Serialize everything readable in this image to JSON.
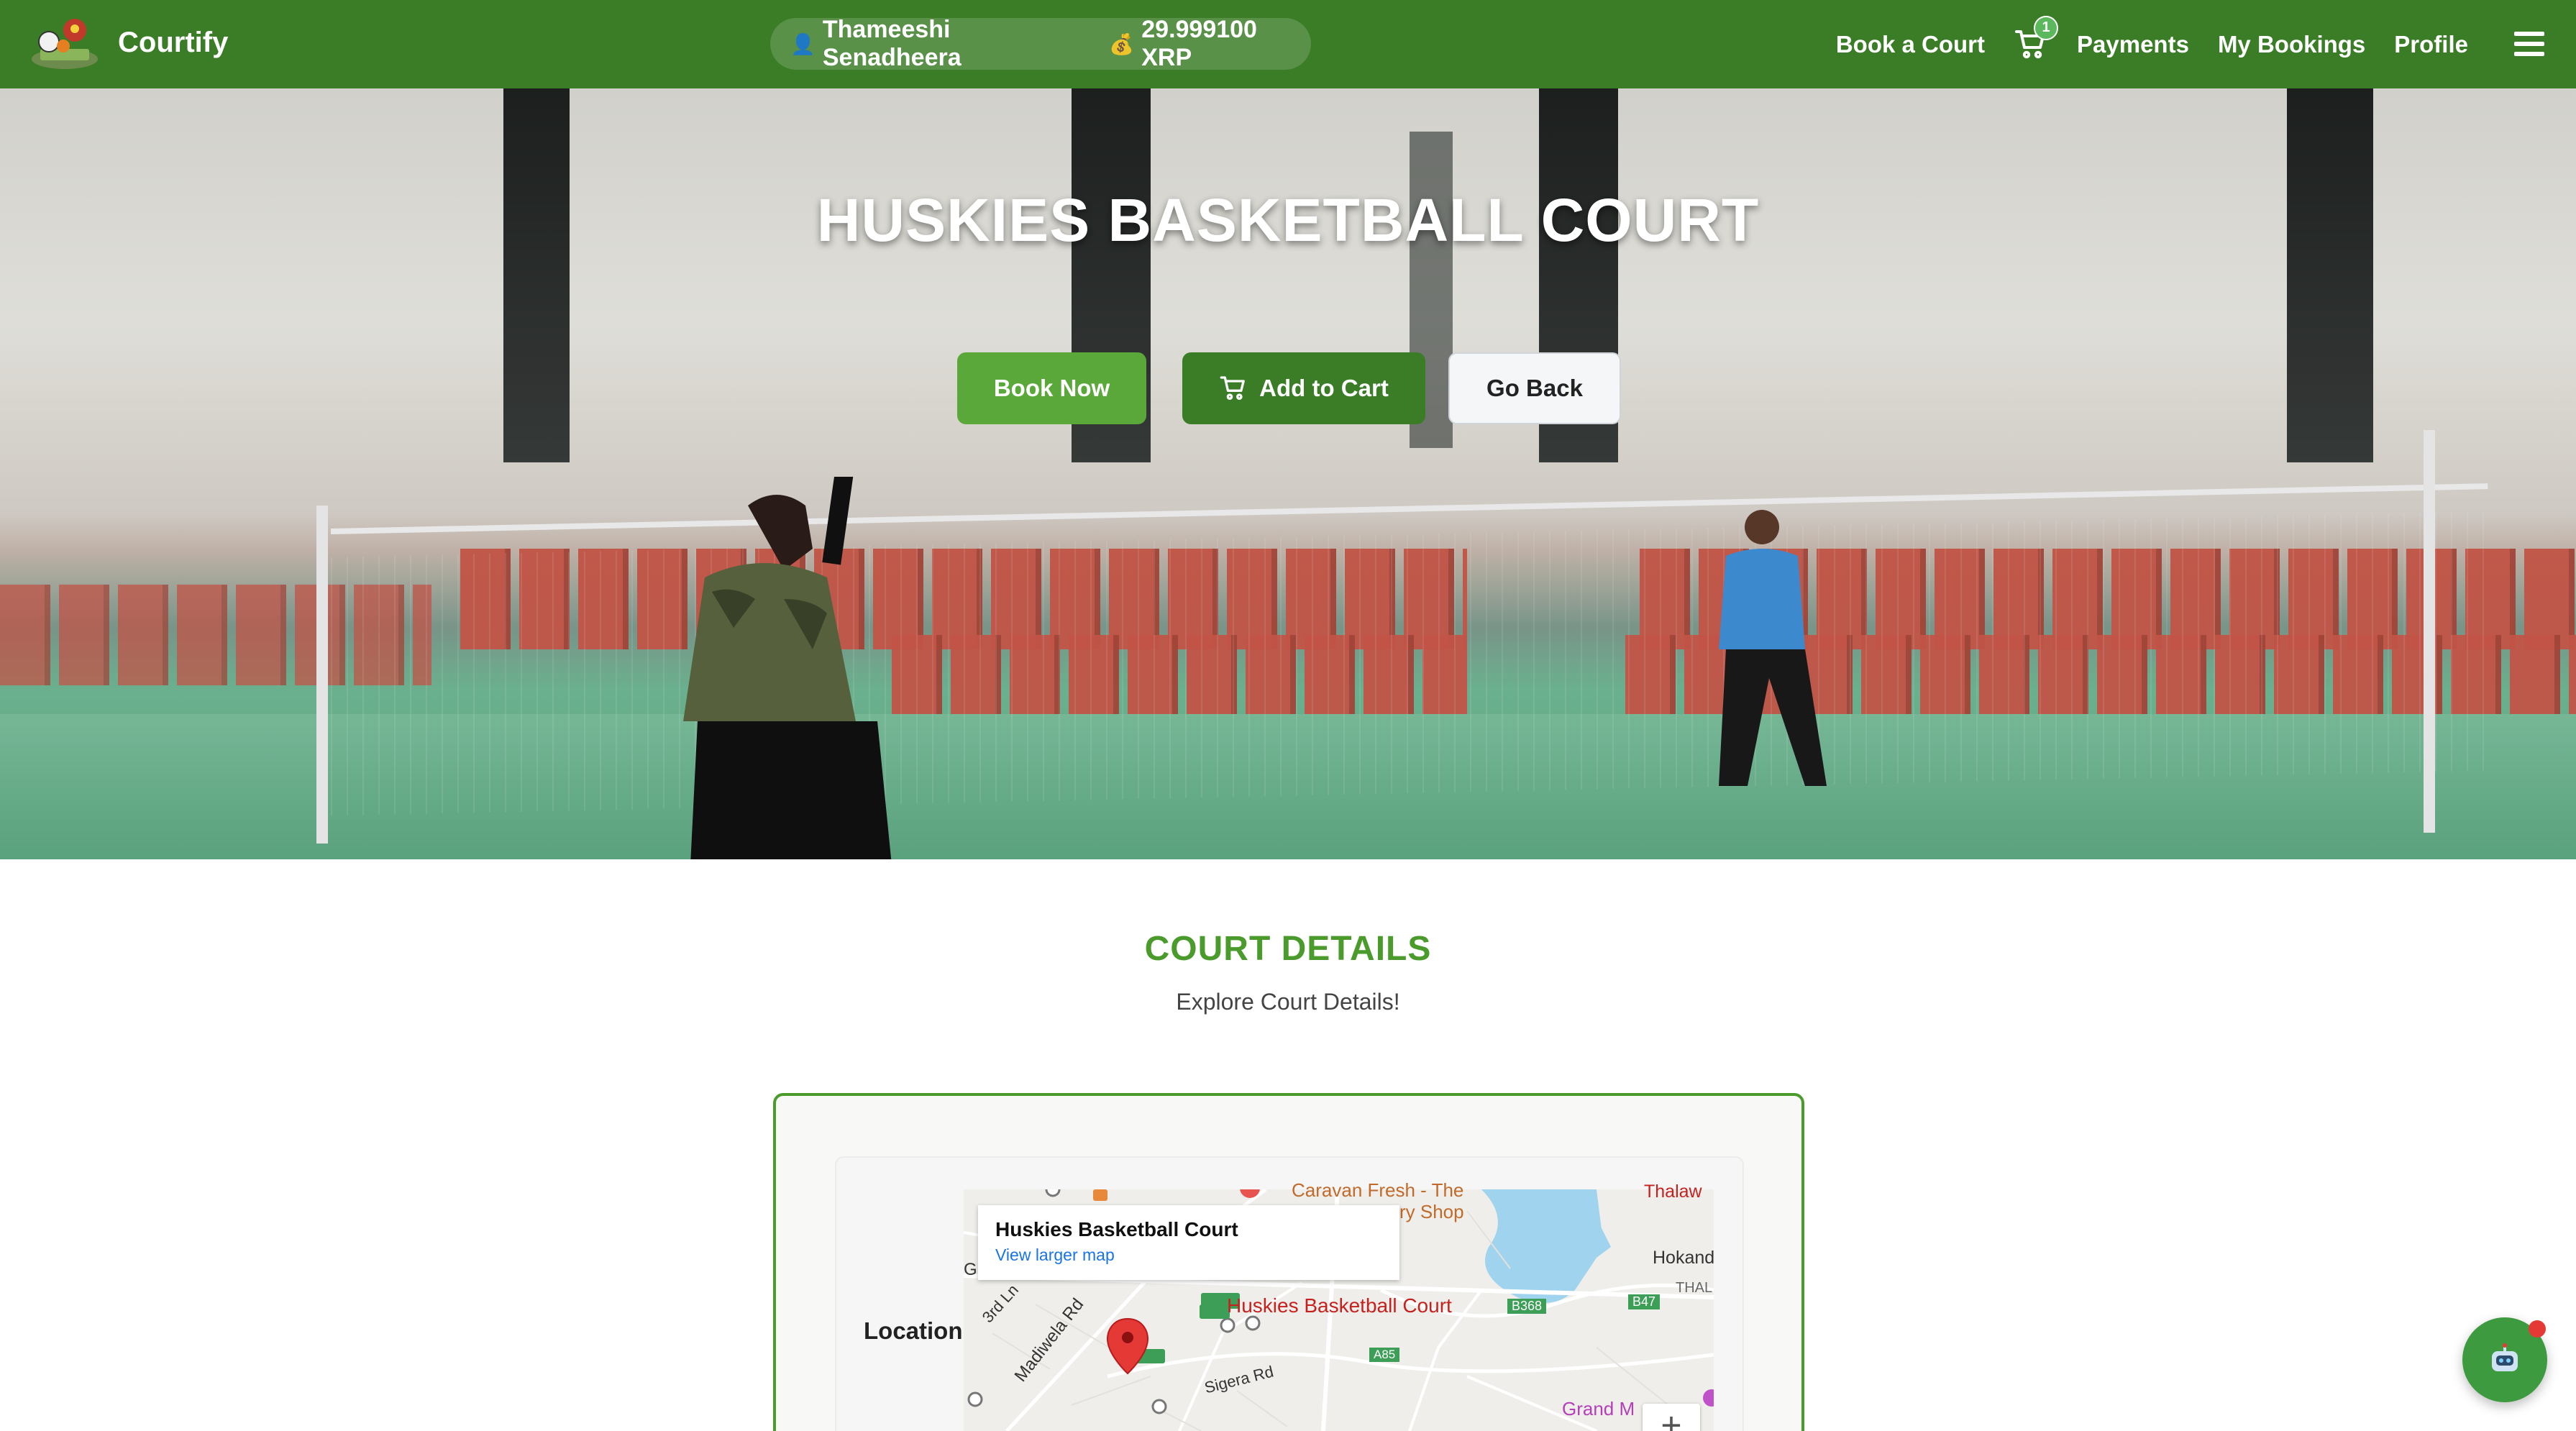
{
  "navbar": {
    "brand": "Courtify",
    "user_name": "Thameeshi Senadheera",
    "balance": "29.999100 XRP",
    "links": {
      "book_court": "Book a Court",
      "payments": "Payments",
      "my_bookings": "My Bookings",
      "profile": "Profile"
    },
    "cart_count": "1",
    "icons": {
      "user": "user-icon",
      "money": "money-bag-icon",
      "cart": "cart-icon",
      "menu": "hamburger-icon"
    }
  },
  "hero": {
    "title": "HUSKIES BASKETBALL COURT",
    "buttons": {
      "book": "Book Now",
      "add_to_cart": "Add to Cart",
      "back": "Go Back"
    }
  },
  "details": {
    "title": "COURT DETAILS",
    "subtitle": "Explore Court Details!",
    "location_label": "Location:"
  },
  "map": {
    "popup_title": "Huskies Basketball Court",
    "popup_link": "View larger map",
    "place_label": "Huskies Basketball Court",
    "labels": {
      "caravan": "Caravan Fresh - The",
      "shop": "ry Shop",
      "thalaw": "Thalaw",
      "hokand": "Hokand",
      "thal": "THAL",
      "madiwela": "Madiwela Rd",
      "third_ln": "3rd Ln",
      "sigera": "Sigera Rd",
      "grand": "Grand M",
      "g": "G",
      "b368": "B368",
      "b47": "B47",
      "a85": "A85"
    },
    "zoom_in": "+"
  },
  "colors": {
    "nav": "#3a7d26",
    "accent": "#4a9b2c",
    "book_btn": "#5aa83a"
  }
}
